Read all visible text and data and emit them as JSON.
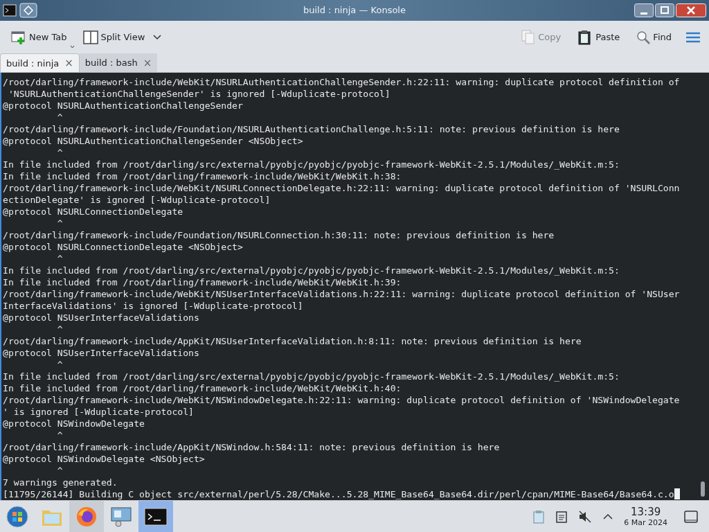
{
  "window": {
    "title": "build : ninja — Konsole"
  },
  "toolbar": [
    {
      "kind": "new-tab",
      "label": "New Tab",
      "disabled": false
    },
    {
      "kind": "split",
      "label": "Split View",
      "disabled": false
    },
    {
      "kind": "copy",
      "label": "Copy",
      "disabled": true
    },
    {
      "kind": "paste",
      "label": "Paste",
      "disabled": false
    },
    {
      "kind": "find",
      "label": "Find",
      "disabled": false
    }
  ],
  "tabs": [
    {
      "label": "build : ninja",
      "close": "×",
      "selected": true
    },
    {
      "label": "build : bash",
      "close": "×",
      "selected": false
    }
  ],
  "terminal": {
    "lines": [
      "/root/darling/framework-include/WebKit/NSURLAuthenticationChallengeSender.h:22:11: warning: duplicate protocol definition of",
      " 'NSURLAuthenticationChallengeSender' is ignored [-Wduplicate-protocol]",
      "@protocol NSURLAuthenticationChallengeSender",
      "          ^",
      "/root/darling/framework-include/Foundation/NSURLAuthenticationChallenge.h:5:11: note: previous definition is here",
      "@protocol NSURLAuthenticationChallengeSender <NSObject>",
      "          ^",
      "In file included from /root/darling/src/external/pyobjc/pyobjc/pyobjc-framework-WebKit-2.5.1/Modules/_WebKit.m:5:",
      "In file included from /root/darling/framework-include/WebKit/WebKit.h:38:",
      "/root/darling/framework-include/WebKit/NSURLConnectionDelegate.h:22:11: warning: duplicate protocol definition of 'NSURLConn",
      "ectionDelegate' is ignored [-Wduplicate-protocol]",
      "@protocol NSURLConnectionDelegate",
      "          ^",
      "/root/darling/framework-include/Foundation/NSURLConnection.h:30:11: note: previous definition is here",
      "@protocol NSURLConnectionDelegate <NSObject>",
      "          ^",
      "In file included from /root/darling/src/external/pyobjc/pyobjc/pyobjc-framework-WebKit-2.5.1/Modules/_WebKit.m:5:",
      "In file included from /root/darling/framework-include/WebKit/WebKit.h:39:",
      "/root/darling/framework-include/WebKit/NSUserInterfaceValidations.h:22:11: warning: duplicate protocol definition of 'NSUser",
      "InterfaceValidations' is ignored [-Wduplicate-protocol]",
      "@protocol NSUserInterfaceValidations",
      "          ^",
      "/root/darling/framework-include/AppKit/NSUserInterfaceValidation.h:8:11: note: previous definition is here",
      "@protocol NSUserInterfaceValidations",
      "          ^",
      "In file included from /root/darling/src/external/pyobjc/pyobjc/pyobjc-framework-WebKit-2.5.1/Modules/_WebKit.m:5:",
      "In file included from /root/darling/framework-include/WebKit/WebKit.h:40:",
      "/root/darling/framework-include/WebKit/NSWindowDelegate.h:22:11: warning: duplicate protocol definition of 'NSWindowDelegate",
      "' is ignored [-Wduplicate-protocol]",
      "@protocol NSWindowDelegate",
      "          ^",
      "/root/darling/framework-include/AppKit/NSWindow.h:584:11: note: previous definition is here",
      "@protocol NSWindowDelegate <NSObject>",
      "          ^",
      "7 warnings generated.",
      "[11795/26144] Building C object src/external/perl/5.28/CMake...5.28_MIME_Base64_Base64.dir/perl/cpan/MIME-Base64/Base64.c.o"
    ]
  },
  "taskbar": {
    "apps": [
      {
        "kind": "start",
        "selected": false
      },
      {
        "kind": "files",
        "selected": false
      },
      {
        "kind": "firefox",
        "selected": false
      },
      {
        "kind": "remote",
        "selected": false
      },
      {
        "kind": "terminal",
        "selected": true
      }
    ],
    "time": "13:39",
    "date": "6 Mar 2024"
  }
}
